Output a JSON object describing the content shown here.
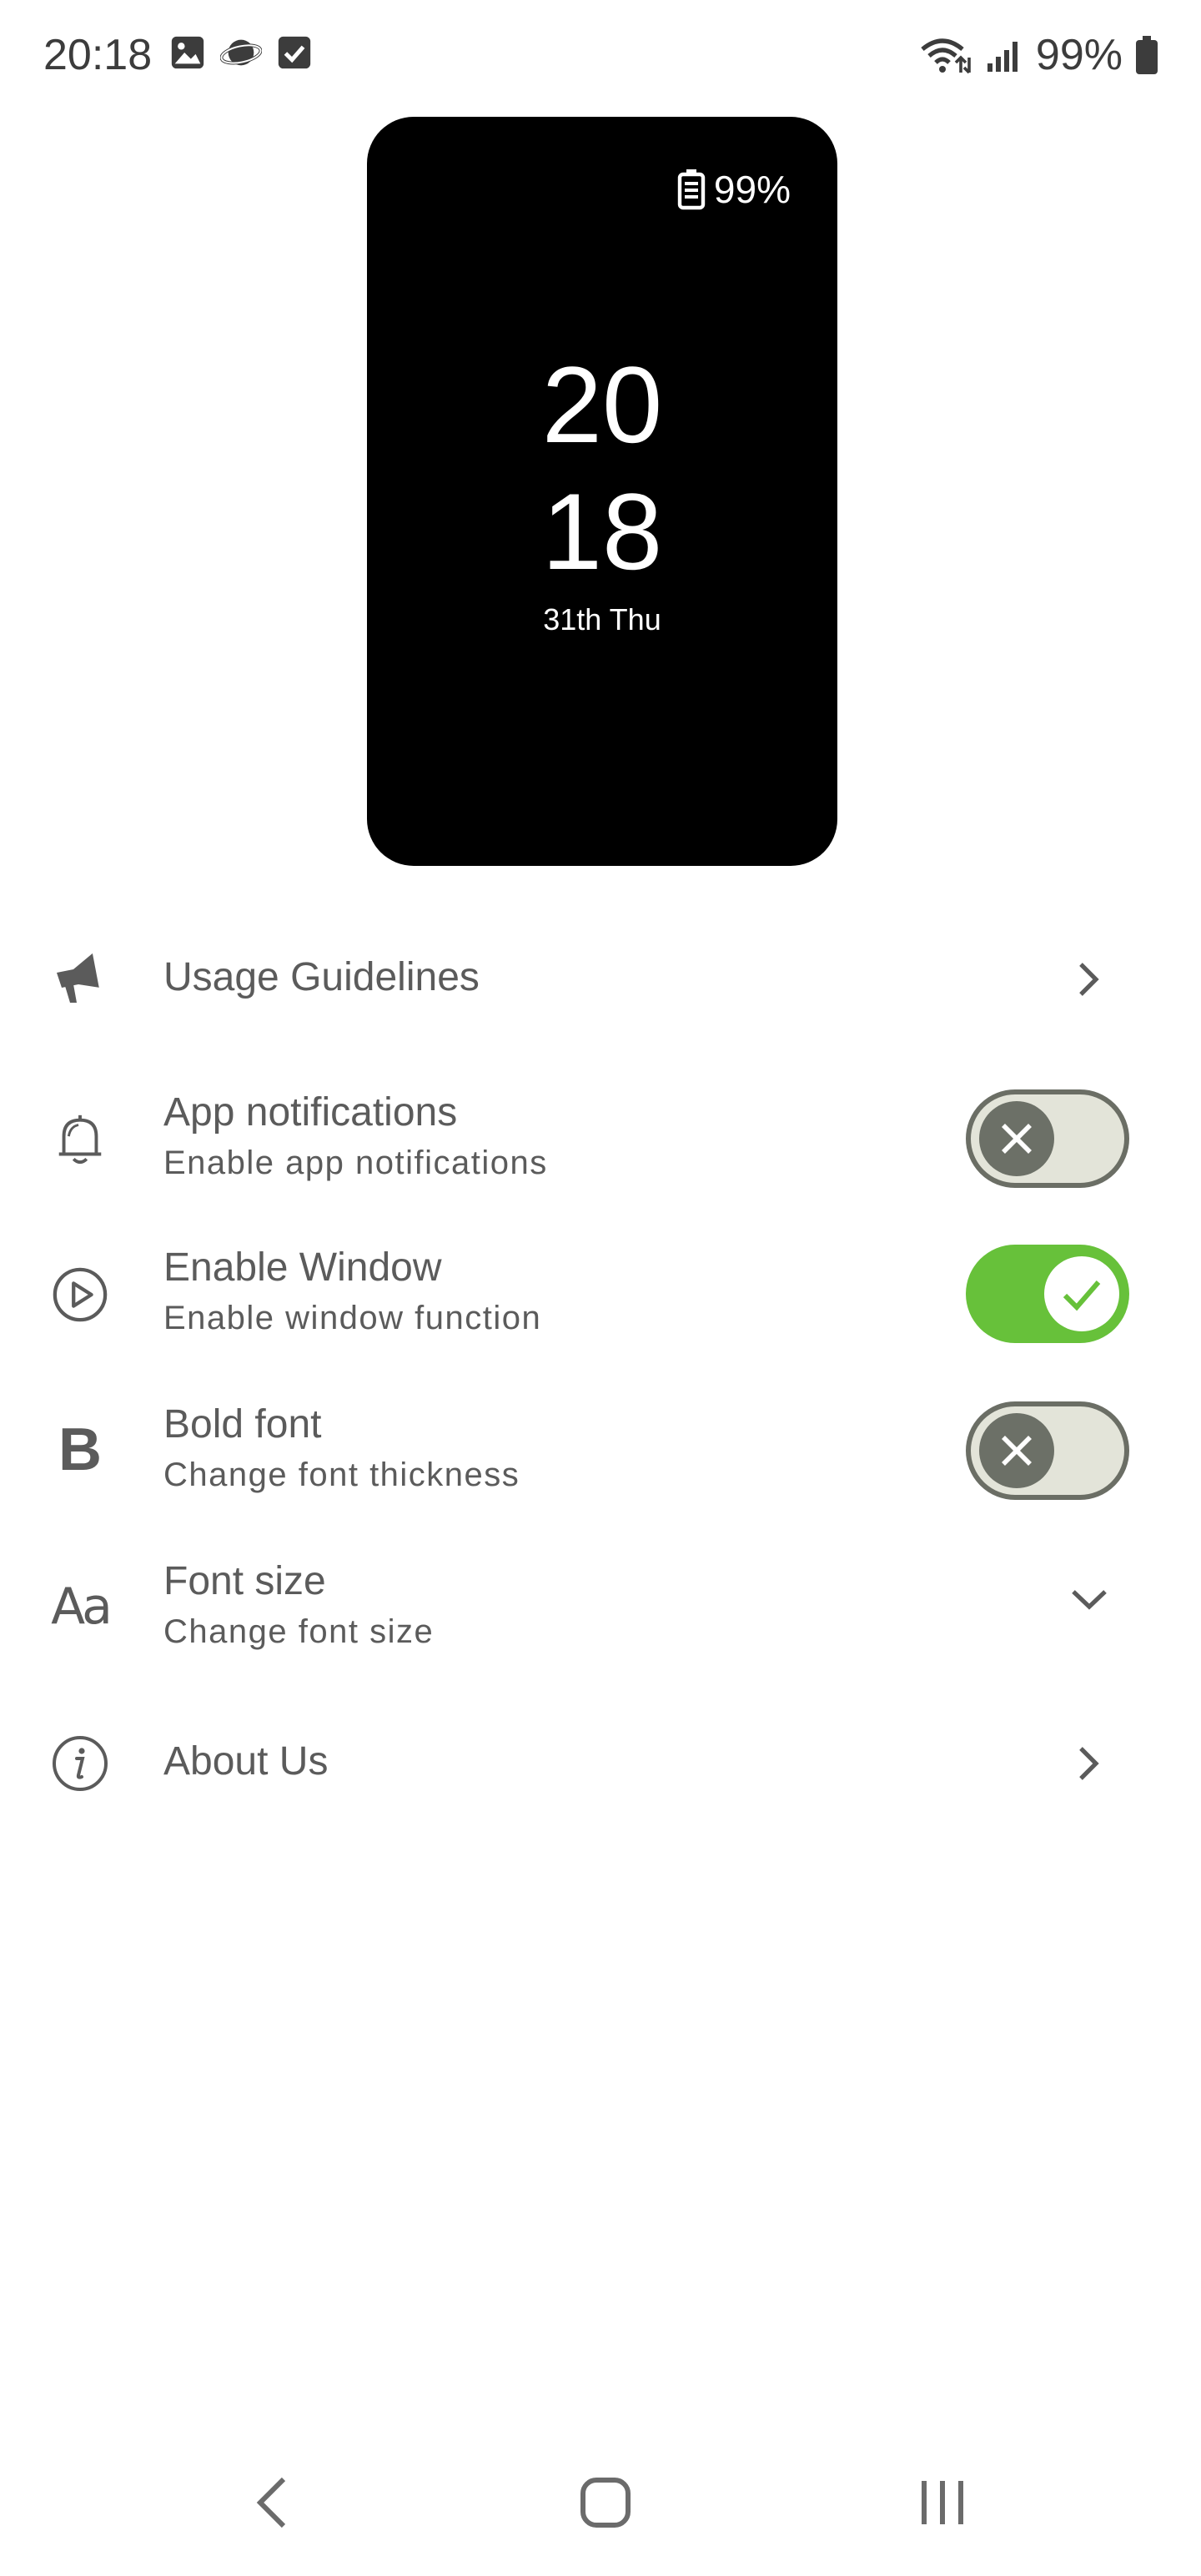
{
  "status_bar": {
    "time": "20:18",
    "battery_text": "99%",
    "left_icons": [
      "image-icon",
      "planet-icon",
      "checkbox-icon"
    ],
    "right_icons": [
      "wifi-icon",
      "signal-icon",
      "battery-icon"
    ]
  },
  "preview": {
    "battery_text": "99%",
    "hours": "20",
    "minutes": "18",
    "date": "31th Thu"
  },
  "settings": {
    "usage": {
      "title": "Usage Guidelines",
      "icon": "megaphone-icon"
    },
    "notifications": {
      "title": "App notifications",
      "subtitle": "Enable app notifications",
      "icon": "bell-icon",
      "enabled": false
    },
    "window": {
      "title": "Enable Window",
      "subtitle": "Enable window function",
      "icon": "play-icon",
      "enabled": true
    },
    "bold": {
      "title": "Bold font",
      "subtitle": "Change font thickness",
      "icon_glyph": "B",
      "enabled": false
    },
    "fontsize": {
      "title": "Font size",
      "subtitle": "Change font size",
      "icon_glyph": "Aa"
    },
    "about": {
      "title": "About Us",
      "icon": "info-icon"
    }
  },
  "colors": {
    "toggle_on": "#67c13a",
    "toggle_off_track": "#e3e4d9",
    "toggle_off_knob": "#6c7067",
    "text": "#5b5b5b"
  }
}
